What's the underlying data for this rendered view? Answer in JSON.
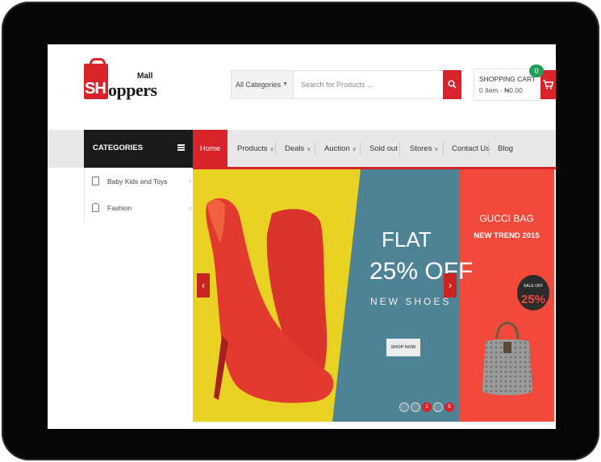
{
  "logo": {
    "prefix": "SH",
    "word": "oppers",
    "tagline": "Mall"
  },
  "search": {
    "category_label": "All Categories",
    "placeholder": "Search for Products ..."
  },
  "cart": {
    "title": "SHOPPING CART",
    "summary": "0 Item - ₦0.00",
    "count": "0"
  },
  "categories": {
    "heading": "CATEGORIES",
    "items": [
      {
        "label": "Baby Kids and Toys"
      },
      {
        "label": "Fashion"
      }
    ]
  },
  "nav": {
    "items": [
      {
        "label": "Home",
        "dropdown": false,
        "active": true
      },
      {
        "label": "Products",
        "dropdown": true
      },
      {
        "label": "Deals",
        "dropdown": true
      },
      {
        "label": "Auction",
        "dropdown": true
      },
      {
        "label": "Sold out",
        "dropdown": false
      },
      {
        "label": "Stores",
        "dropdown": true
      },
      {
        "label": "Contact Us",
        "dropdown": false
      },
      {
        "label": "Blog",
        "dropdown": false
      }
    ]
  },
  "banner": {
    "headline": "FLAT",
    "discount": "25% OFF",
    "subline": "NEW SHOES",
    "cta": "SHOP NOW",
    "side_title": "GUCCI BAG",
    "side_subtitle": "NEW TREND 2015",
    "sale_label": "SALE OFF",
    "sale_value": "25%",
    "slides": [
      "",
      "",
      "1",
      "",
      "5"
    ],
    "active_slide": 2
  },
  "colors": {
    "accent": "#d8232a",
    "nav_bg": "#e8e8e8",
    "categories_bg": "#1a1a1a",
    "badge": "#1f9e5c",
    "banner_yellow": "#ead225",
    "banner_blue": "#4e8295",
    "banner_red": "#f14a3c"
  }
}
